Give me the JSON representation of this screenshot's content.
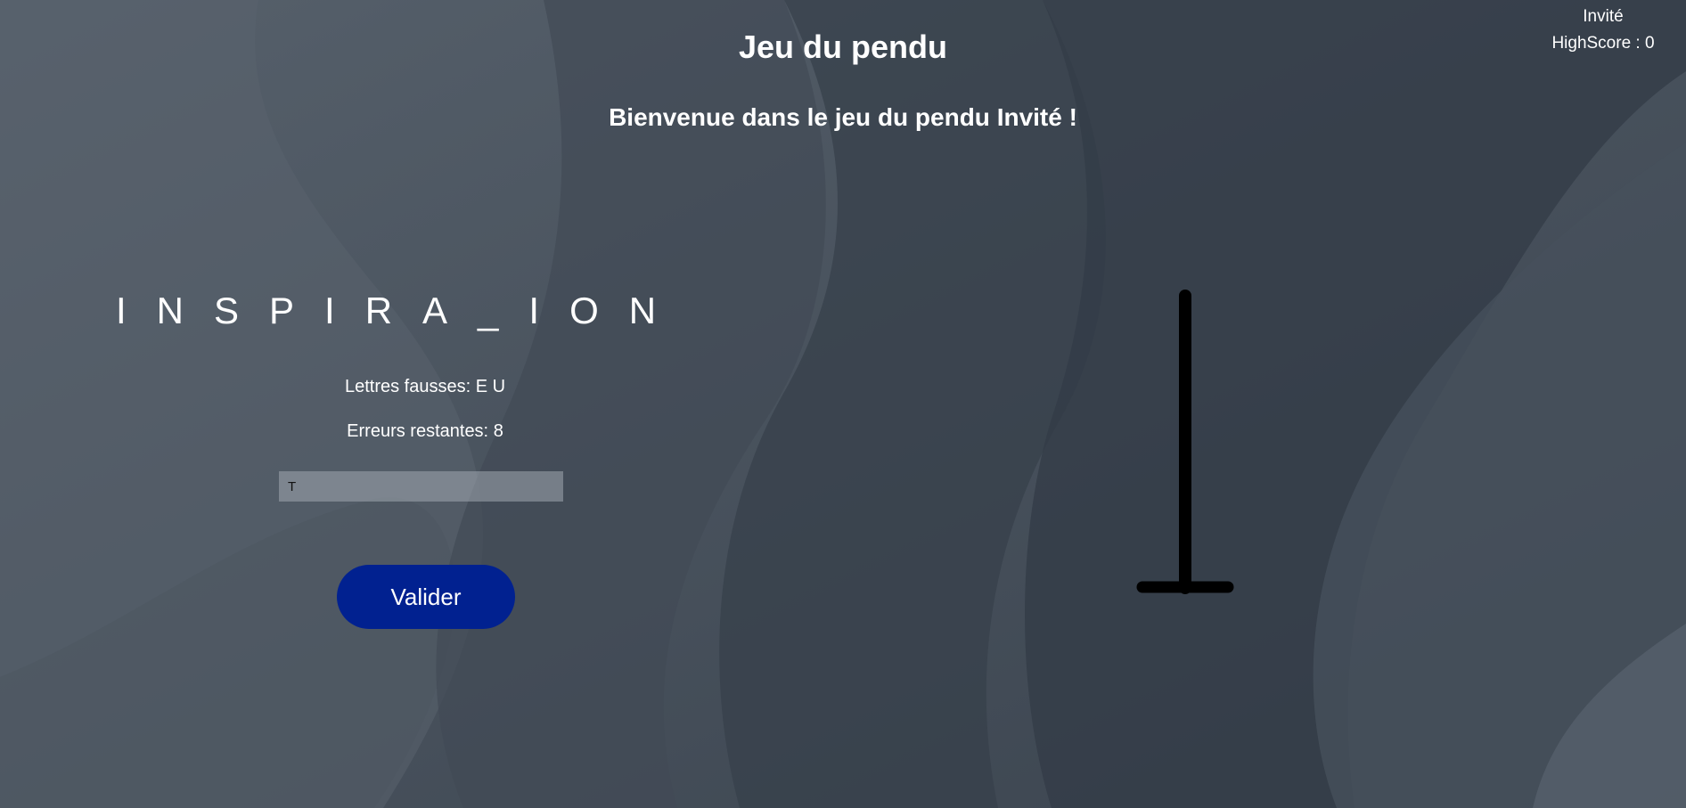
{
  "header": {
    "username": "Invité",
    "highscore_text": "HighScore : 0"
  },
  "game": {
    "title": "Jeu du pendu",
    "welcome_text": "Bienvenue dans le jeu du pendu Invité !",
    "word_display": "INSPIRA_ION",
    "wrong_letters_label": "Lettres fausses:",
    "wrong_letters": "E U",
    "remaining_errors_label": "Erreurs restantes:",
    "remaining_errors": "8",
    "input_value": "T",
    "validate_label": "Valider",
    "hangman_stage_parts_drawn": [
      "pole",
      "base"
    ]
  },
  "colors": {
    "background": "#3c4550",
    "button": "#012190",
    "text": "#ffffff",
    "gallows": "#000000"
  }
}
